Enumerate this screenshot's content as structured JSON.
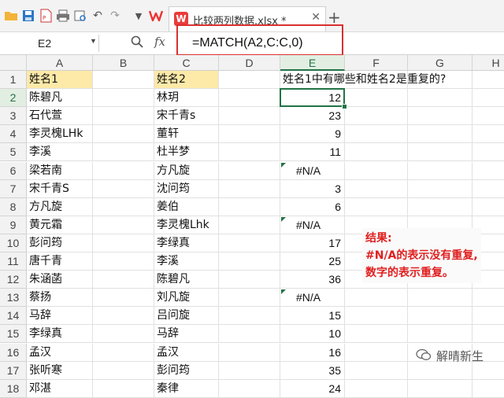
{
  "app": {
    "doc_tab_title": "比较两列数据.xlsx *",
    "app_icon_label": "W"
  },
  "toolbar": {
    "icons": [
      "open-folder-icon",
      "save-icon",
      "export-pdf-icon",
      "print-icon",
      "print-preview-icon",
      "undo-icon",
      "redo-icon",
      "more-icon"
    ]
  },
  "formula_bar": {
    "name_box": "E2",
    "fx_label": "fx",
    "formula": "=MATCH(A2,C:C,0)"
  },
  "columns": [
    "A",
    "B",
    "C",
    "D",
    "E",
    "F",
    "G",
    "H"
  ],
  "rows": [
    {
      "n": "1",
      "a": "姓名1",
      "c": "姓名2",
      "e": "姓名1中有哪些和姓名2是重复的?",
      "e_type": "text"
    },
    {
      "n": "2",
      "a": "陈碧凡",
      "c": "林玥",
      "e": "12",
      "e_type": "num"
    },
    {
      "n": "3",
      "a": "石代萱",
      "c": "宋千青s",
      "e": "23",
      "e_type": "num"
    },
    {
      "n": "4",
      "a": "李灵槐LHk",
      "c": "董轩",
      "e": "9",
      "e_type": "num"
    },
    {
      "n": "5",
      "a": "李溪",
      "c": "杜半梦",
      "e": "11",
      "e_type": "num"
    },
    {
      "n": "6",
      "a": "梁若南",
      "c": "方凡旋",
      "e": "#N/A",
      "e_type": "err"
    },
    {
      "n": "7",
      "a": "宋千青S",
      "c": "沈问筠",
      "e": "3",
      "e_type": "num"
    },
    {
      "n": "8",
      "a": "方凡旋",
      "c": "姜伯",
      "e": "6",
      "e_type": "num"
    },
    {
      "n": "9",
      "a": "黄元霜",
      "c": "李灵槐Lhk",
      "e": "#N/A",
      "e_type": "err"
    },
    {
      "n": "10",
      "a": "彭问筠",
      "c": "李绿真",
      "e": "17",
      "e_type": "num"
    },
    {
      "n": "11",
      "a": "唐千青",
      "c": "李溪",
      "e": "25",
      "e_type": "num"
    },
    {
      "n": "12",
      "a": "朱涵菡",
      "c": "陈碧凡",
      "e": "36",
      "e_type": "num"
    },
    {
      "n": "13",
      "a": "蔡扬",
      "c": "刘凡旋",
      "e": "#N/A",
      "e_type": "err"
    },
    {
      "n": "14",
      "a": "马辞",
      "c": "吕问旋",
      "e": "15",
      "e_type": "num"
    },
    {
      "n": "15",
      "a": "李绿真",
      "c": "马辞",
      "e": "10",
      "e_type": "num"
    },
    {
      "n": "16",
      "a": "孟汉",
      "c": "孟汉",
      "e": "16",
      "e_type": "num"
    },
    {
      "n": "17",
      "a": "张听寒",
      "c": "彭问筠",
      "e": "35",
      "e_type": "num"
    },
    {
      "n": "18",
      "a": "邓湛",
      "c": "秦律",
      "e": "24",
      "e_type": "num"
    }
  ],
  "annotation": {
    "line1": "结果:",
    "line2": "#N/A的表示没有重复,",
    "line3": "数字的表示重复。"
  },
  "watermark": {
    "text": "解晴新生",
    "icon": "wechat-icon"
  },
  "colors": {
    "accent_green": "#217346",
    "header_fill": "#fde9a8",
    "annotation_red": "#e02020",
    "highlight_border_red": "#d93030"
  }
}
